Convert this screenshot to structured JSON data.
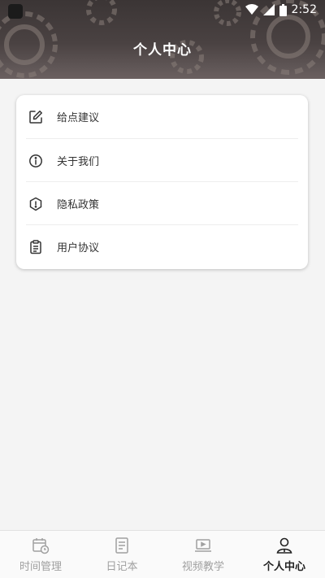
{
  "status_bar": {
    "time": "2:52"
  },
  "header": {
    "title": "个人中心"
  },
  "menu": [
    {
      "label": "给点建议",
      "icon": "edit-icon"
    },
    {
      "label": "关于我们",
      "icon": "info-icon"
    },
    {
      "label": "隐私政策",
      "icon": "shield-icon"
    },
    {
      "label": "用户协议",
      "icon": "clipboard-icon"
    }
  ],
  "bottom_nav": [
    {
      "label": "时间管理",
      "icon": "calendar-clock-icon",
      "active": false
    },
    {
      "label": "日记本",
      "icon": "notebook-icon",
      "active": false
    },
    {
      "label": "视频教学",
      "icon": "laptop-icon",
      "active": false
    },
    {
      "label": "个人中心",
      "icon": "user-icon",
      "active": true
    }
  ],
  "colors": {
    "header_bg": "#3b3535",
    "accent": "#222222",
    "inactive": "#a0a0a0"
  }
}
